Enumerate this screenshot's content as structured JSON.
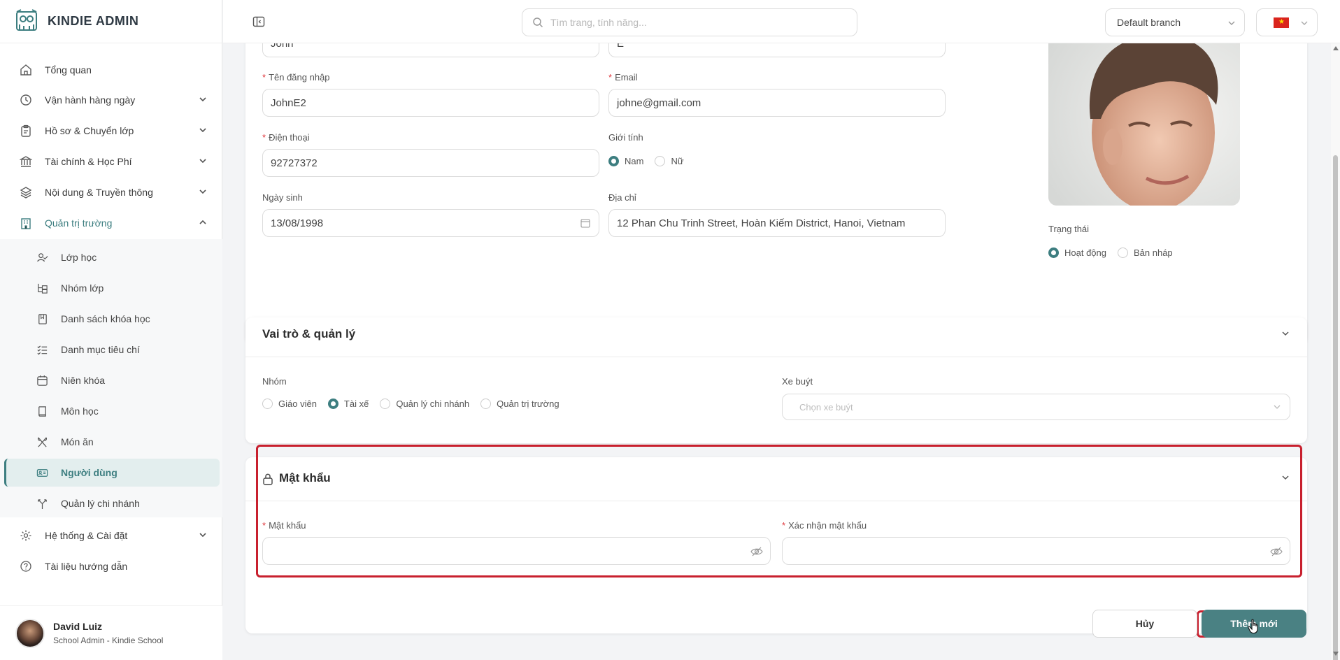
{
  "brand": {
    "title": "KINDIE ADMIN"
  },
  "search": {
    "placeholder": "Tìm trang, tính năng..."
  },
  "branch": {
    "value": "Default branch"
  },
  "menu": {
    "overview": "Tổng quan",
    "daily": "Vận hành hàng ngày",
    "profiles": "Hồ sơ & Chuyển lớp",
    "finance": "Tài chính & Học Phí",
    "content": "Nội dung & Truyền thông",
    "school_admin": "Quản trị trường",
    "settings": "Hệ thống & Cài đặt",
    "docs": "Tài liệu hướng dẫn"
  },
  "submenu": {
    "classes": "Lớp học",
    "class_groups": "Nhóm lớp",
    "courses": "Danh sách khóa học",
    "criteria": "Danh mục tiêu chí",
    "school_year": "Niên khóa",
    "subjects": "Môn học",
    "meals": "Món ăn",
    "users": "Người dùng",
    "branch_mgmt": "Quản lý chi nhánh"
  },
  "user": {
    "name": "David Luiz",
    "role": "School Admin - Kindie School"
  },
  "form": {
    "first_name_value": "John",
    "last_name_value": "E",
    "username_label": "Tên đăng nhập",
    "username_value": "JohnE2",
    "email_label": "Email",
    "email_value": "johne@gmail.com",
    "phone_label": "Điện thoại",
    "phone_value": "92727372",
    "gender_label": "Giới tính",
    "gender_male": "Nam",
    "gender_female": "Nữ",
    "dob_label": "Ngày sinh",
    "dob_value": "13/08/1998",
    "address_label": "Địa chỉ",
    "address_value": "12 Phan Chu Trinh Street, Hoàn Kiếm District, Hanoi, Vietnam",
    "status_label": "Trạng thái",
    "status_active": "Hoạt động",
    "status_draft": "Bản nháp"
  },
  "roles": {
    "title": "Vai trò & quản lý",
    "group_label": "Nhóm",
    "options": [
      "Giáo viên",
      "Tài xế",
      "Quản lý chi nhánh",
      "Quản trị trường"
    ],
    "bus_label": "Xe buýt",
    "bus_placeholder": "Chọn xe buýt"
  },
  "password": {
    "title": "Mật khẩu",
    "password_label": "Mật khẩu",
    "confirm_label": "Xác nhận mật khẩu"
  },
  "actions": {
    "cancel": "Hủy",
    "submit": "Thêm mới"
  },
  "colors": {
    "accent": "#3d7e80",
    "highlight": "#c8202e",
    "required": "#e0393e"
  }
}
